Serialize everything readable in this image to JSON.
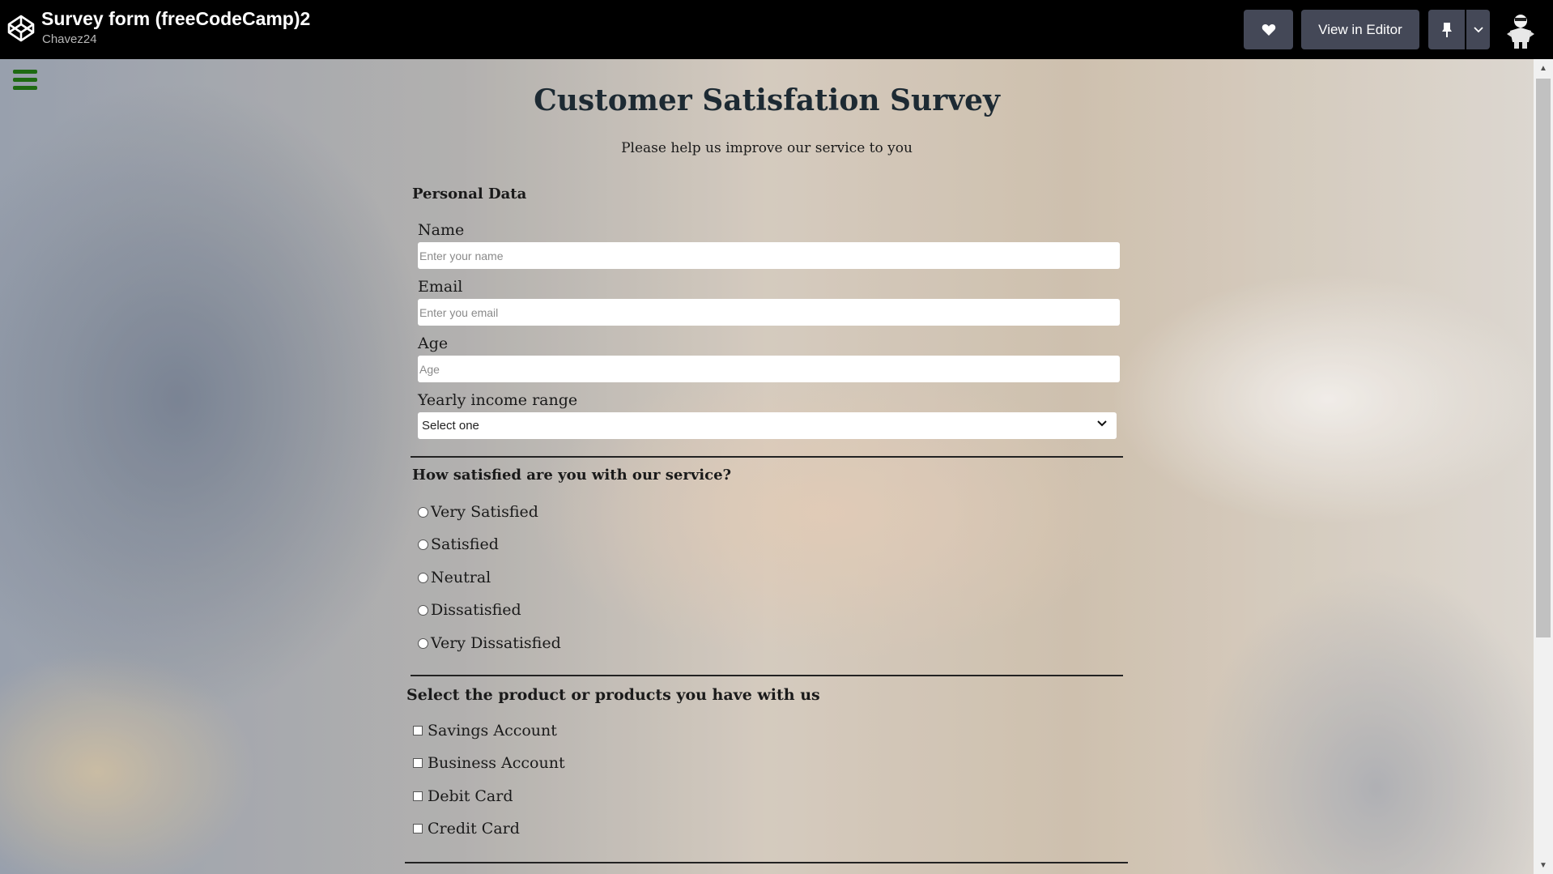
{
  "header": {
    "pen_title": "Survey form (freeCodeCamp)2",
    "author": "Chavez24",
    "view_in_editor_label": "View in Editor",
    "icons": [
      "codepen-logo-icon",
      "heart-icon",
      "pin-icon",
      "chevron-down-icon",
      "avatar"
    ]
  },
  "survey": {
    "title": "Customer Satisfation Survey",
    "subtitle": "Please help us improve our service to you",
    "personal_section": "Personal Data",
    "fields": [
      {
        "label": "Name",
        "placeholder": "Enter your name"
      },
      {
        "label": "Email",
        "placeholder": "Enter you email"
      },
      {
        "label": "Age",
        "placeholder": "Age"
      }
    ],
    "income": {
      "label": "Yearly income range",
      "selected": "Select one"
    },
    "satisfaction_question": "How satisfied are you with our service?",
    "satisfaction_options": [
      "Very Satisfied",
      "Satisfied",
      "Neutral",
      "Dissatisfied",
      "Very Dissatisfied"
    ],
    "products_question": "Select the product or products you have with us",
    "products": [
      "Savings Account",
      "Business Account",
      "Debit Card",
      "Credit Card"
    ]
  },
  "colors": {
    "menu_icon": "#1e6a12",
    "title": "#1d2a33",
    "header_bg": "#000000",
    "button_bg": "#444857"
  }
}
